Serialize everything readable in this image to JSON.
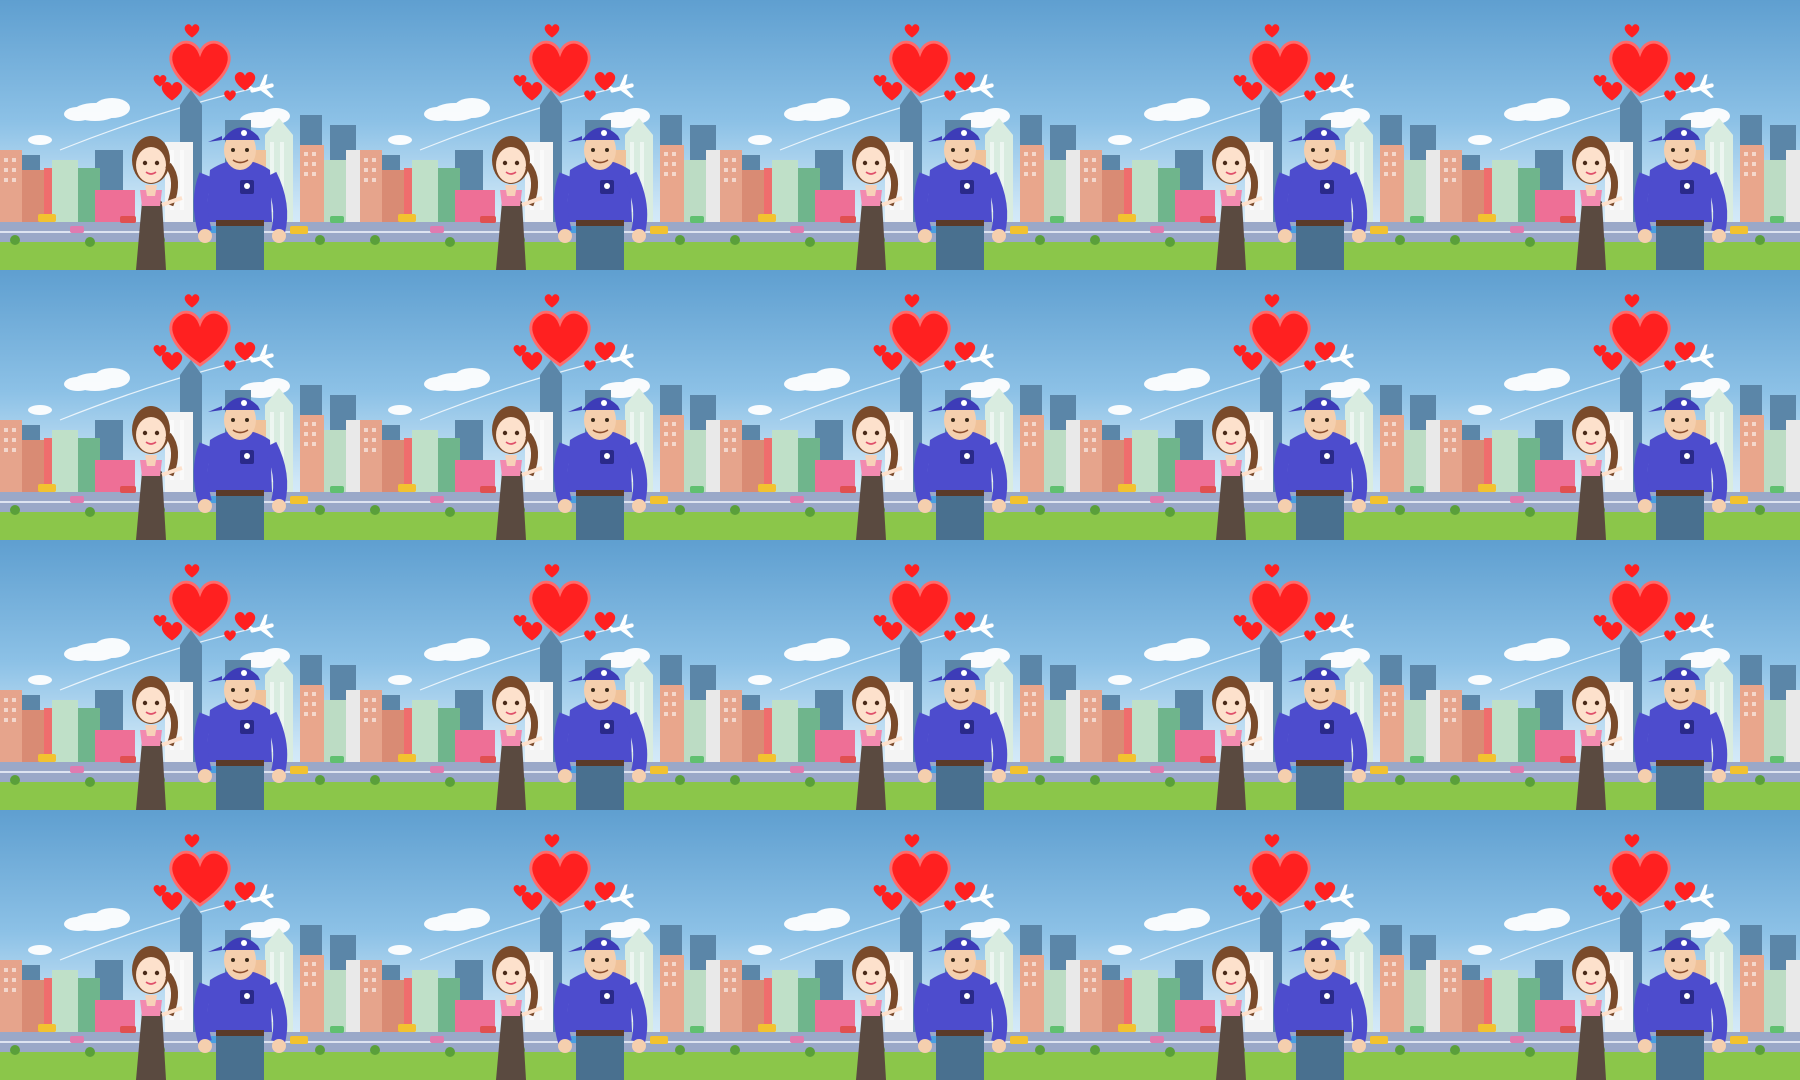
{
  "wallpaper": {
    "rows": 4,
    "columns": 5,
    "tile_motif": [
      "sky",
      "clouds",
      "big-red-heart",
      "small-hearts",
      "airplane",
      "city-skyline",
      "road",
      "cars",
      "grass",
      "trees",
      "woman",
      "man-in-blue-cap"
    ],
    "colors": {
      "sky_top": "#5f9fd0",
      "sky_bottom": "#e9f4fb",
      "heart": "#ff2020",
      "shirt": "#4d4ccd",
      "grass": "#8bc64a",
      "road": "#9aa8c8"
    }
  }
}
